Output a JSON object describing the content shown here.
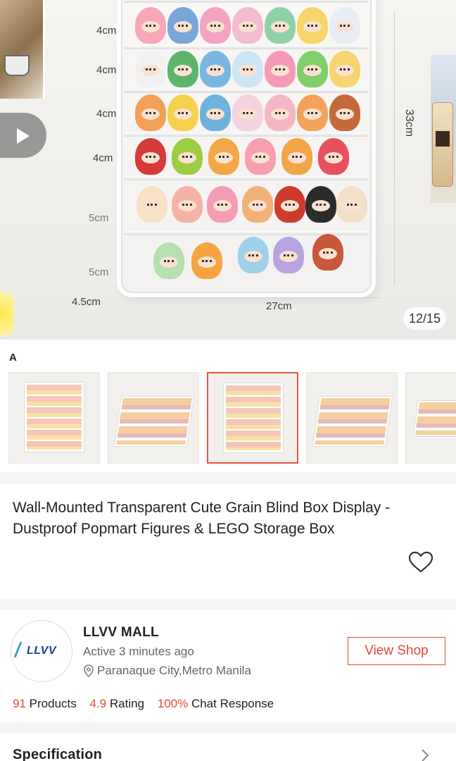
{
  "gallery": {
    "counter": "12/15",
    "dimensions": {
      "rows": [
        "4cm",
        "4cm",
        "4cm",
        "4cm",
        "5cm",
        "5cm"
      ],
      "height": "33cm",
      "depth": "4.5cm",
      "width": "27cm"
    }
  },
  "variant": {
    "label": "A",
    "selected_index": 2,
    "thumb_count": 5
  },
  "product": {
    "title": "Wall-Mounted Transparent Cute Grain Blind Box Display - Dustproof Popmart Figures & LEGO Storage Box"
  },
  "shop": {
    "logo_text": "LLVV",
    "name": "LLVV MALL",
    "active": "Active 3 minutes ago",
    "location": "Paranaque City,Metro Manila",
    "view_shop_label": "View Shop",
    "stats": {
      "products_value": "91",
      "products_label": "Products",
      "rating_value": "4.9",
      "rating_label": "Rating",
      "response_value": "100%",
      "response_label": "Chat Response"
    }
  },
  "specification": {
    "label": "Specification"
  },
  "colors": {
    "accent": "#e2473a",
    "selected_border": "#e9543f"
  },
  "icons": [
    "play-icon",
    "heart-icon",
    "location-pin-icon",
    "chevron-right-icon"
  ]
}
